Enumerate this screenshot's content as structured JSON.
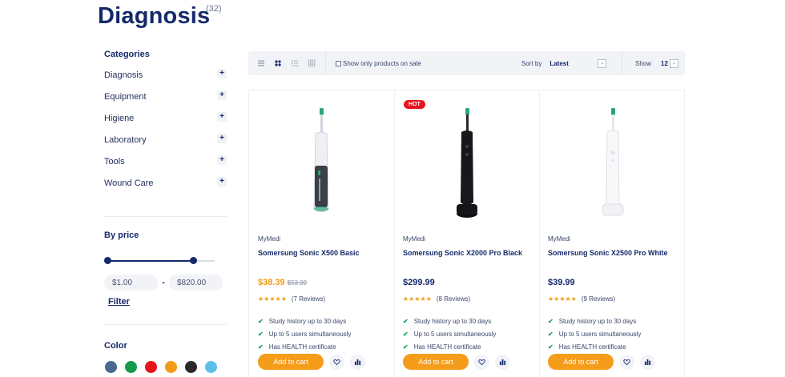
{
  "page": {
    "title": "Diagnosis",
    "count": "(32)"
  },
  "sidebar": {
    "categories_heading": "Categories",
    "categories": [
      {
        "label": "Diagnosis"
      },
      {
        "label": "Equipment"
      },
      {
        "label": "Higiene"
      },
      {
        "label": "Laboratory"
      },
      {
        "label": "Tools"
      },
      {
        "label": "Wound Care"
      }
    ],
    "expand_symbol": "+",
    "price_heading": "By price",
    "price_min": "$1.00",
    "price_max": "$820.00",
    "price_separator": "-",
    "slider_min_fraction": 0.0,
    "slider_max_fraction": 0.83,
    "filter_label": "Filter",
    "color_heading": "Color",
    "colors": [
      "#4a6890",
      "#159a4b",
      "#e8141b",
      "#f39a17",
      "#2a2a2e",
      "#5bc0e8"
    ]
  },
  "toolbar": {
    "view_icons": [
      "list-view-icon",
      "grid-2-view-icon",
      "grid-3-view-icon",
      "grid-4-view-icon"
    ],
    "onsale_label": "Show only products on sale",
    "sort_label": "Sort by",
    "sort_value": "Latest",
    "show_label": "Show",
    "show_value": "12",
    "dropdown_arrow": "⌄"
  },
  "products": [
    {
      "badge": "",
      "brand": "MyMedi",
      "name": "Somersung Sonic X500 Basic",
      "price": "$38.39",
      "old_price": "$53.99",
      "rating_stars": "★★★★★",
      "reviews": "(7 Reviews)",
      "features": [
        "Study history up to 30 days",
        "Up to 5 users simultaneously",
        "Has HEALTH certificate"
      ],
      "cart_label": "Add to cart"
    },
    {
      "badge": "HOT",
      "brand": "MyMedi",
      "name": "Somersung Sonic X2000 Pro Black",
      "price": "$299.99",
      "old_price": "",
      "rating_stars": "★★★★★",
      "reviews": "(8 Reviews)",
      "features": [
        "Study history up to 30 days",
        "Up to 5 users simultaneously",
        "Has HEALTH certificate"
      ],
      "cart_label": "Add to cart"
    },
    {
      "badge": "",
      "brand": "MyMedi",
      "name": "Somersung Sonic X2500 Pro White",
      "price": "$39.99",
      "old_price": "",
      "rating_stars": "★★★★★",
      "reviews": "(9 Reviews)",
      "features": [
        "Study history up to 30 days",
        "Up to 5 users simultaneously",
        "Has HEALTH certificate"
      ],
      "cart_label": "Add to cart"
    }
  ],
  "checkmark": "✔",
  "colors": {
    "accent": "#f59c1a",
    "brand": "#152a6b",
    "hot": "#e8141b",
    "check": "#1aa35a"
  }
}
